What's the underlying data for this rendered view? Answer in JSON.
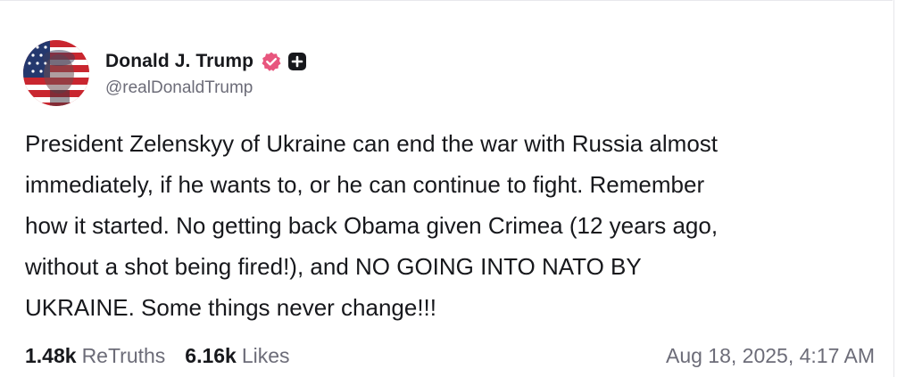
{
  "post": {
    "author": {
      "display_name": "Donald J. Trump",
      "handle": "@realDonaldTrump"
    },
    "text": "President Zelenskyy of Ukraine can end the war with Russia almost\nimmediately, if he wants to, or he can continue to fight. Remember\nhow it started. No getting back Obama given Crimea (12 years ago,\nwithout a shot being fired!), and NO GOING INTO NATO BY\nUKRAINE. Some things never change!!!",
    "stats": {
      "retruths_count": "1.48k",
      "retruths_label": "ReTruths",
      "likes_count": "6.16k",
      "likes_label": "Likes"
    },
    "timestamp": "Aug 18, 2025, 4:17 AM"
  },
  "icons": {
    "verified": "verified-badge-icon",
    "plus": "plus-square-icon"
  },
  "colors": {
    "verified_badge": "#e8567e",
    "text_primary": "#17181c",
    "text_secondary": "#6c6c78"
  }
}
